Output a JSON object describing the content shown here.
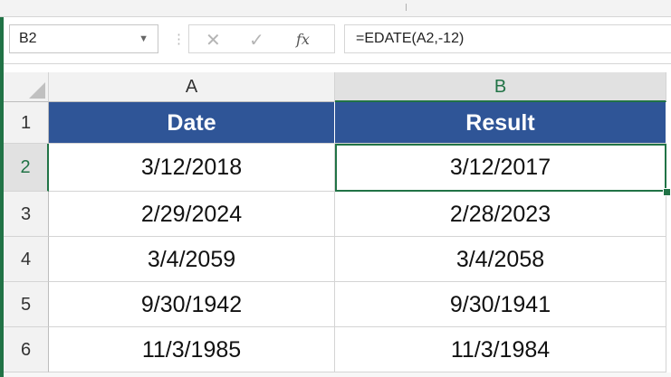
{
  "name_box": {
    "value": "B2"
  },
  "formula_bar": {
    "cancel_glyph": "✕",
    "enter_glyph": "✓",
    "fx_label": "fx",
    "formula": "=EDATE(A2,-12)"
  },
  "columns": [
    "A",
    "B"
  ],
  "rows": [
    "1",
    "2",
    "3",
    "4",
    "5",
    "6"
  ],
  "selected": {
    "column": "B",
    "row": "2"
  },
  "table": {
    "headers": [
      "Date",
      "Result"
    ],
    "header_color": "#2f5597",
    "rows": [
      [
        "3/12/2018",
        "3/12/2017"
      ],
      [
        "2/29/2024",
        "2/28/2023"
      ],
      [
        "3/4/2059",
        "3/4/2058"
      ],
      [
        "9/30/1942",
        "9/30/1941"
      ],
      [
        "11/3/1985",
        "11/3/1984"
      ]
    ]
  },
  "accent_color": "#217346"
}
